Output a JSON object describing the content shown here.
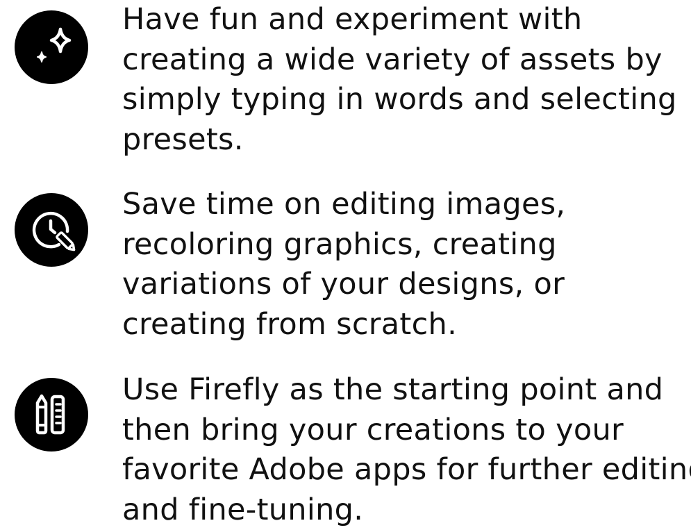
{
  "features": [
    {
      "icon": "sparkle-icon",
      "lines": [
        "Have fun and experiment with",
        "creating a wide variety of assets by",
        "simply typing in words and selecting",
        "presets."
      ]
    },
    {
      "icon": "clock-pencil-icon",
      "lines": [
        "Save time on editing images,",
        "recoloring graphics, creating",
        "variations of your designs, or",
        "creating from scratch."
      ]
    },
    {
      "icon": "pencil-ruler-icon",
      "lines": [
        "Use Firefly as the starting point and",
        "then bring your creations to your",
        "favorite Adobe apps for further editing",
        "and fine-tuning."
      ]
    }
  ],
  "colors": {
    "icon_background": "#000000",
    "icon_foreground": "#ffffff",
    "text": "#111111",
    "page_background": "#ffffff"
  }
}
